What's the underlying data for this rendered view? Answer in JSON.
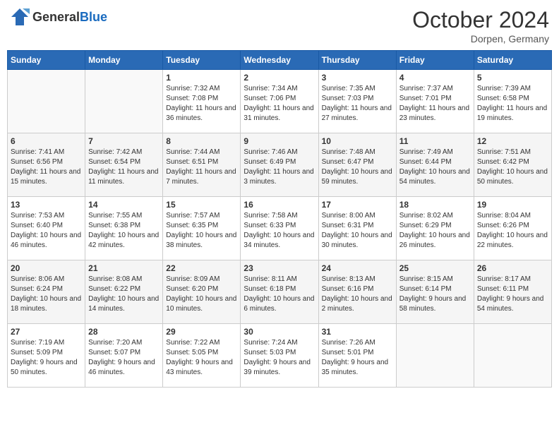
{
  "header": {
    "logo_general": "General",
    "logo_blue": "Blue",
    "month": "October 2024",
    "location": "Dorpen, Germany"
  },
  "weekdays": [
    "Sunday",
    "Monday",
    "Tuesday",
    "Wednesday",
    "Thursday",
    "Friday",
    "Saturday"
  ],
  "weeks": [
    [
      {
        "day": "",
        "empty": true
      },
      {
        "day": "",
        "empty": true
      },
      {
        "day": "1",
        "sunrise": "Sunrise: 7:32 AM",
        "sunset": "Sunset: 7:08 PM",
        "daylight": "Daylight: 11 hours and 36 minutes."
      },
      {
        "day": "2",
        "sunrise": "Sunrise: 7:34 AM",
        "sunset": "Sunset: 7:06 PM",
        "daylight": "Daylight: 11 hours and 31 minutes."
      },
      {
        "day": "3",
        "sunrise": "Sunrise: 7:35 AM",
        "sunset": "Sunset: 7:03 PM",
        "daylight": "Daylight: 11 hours and 27 minutes."
      },
      {
        "day": "4",
        "sunrise": "Sunrise: 7:37 AM",
        "sunset": "Sunset: 7:01 PM",
        "daylight": "Daylight: 11 hours and 23 minutes."
      },
      {
        "day": "5",
        "sunrise": "Sunrise: 7:39 AM",
        "sunset": "Sunset: 6:58 PM",
        "daylight": "Daylight: 11 hours and 19 minutes."
      }
    ],
    [
      {
        "day": "6",
        "sunrise": "Sunrise: 7:41 AM",
        "sunset": "Sunset: 6:56 PM",
        "daylight": "Daylight: 11 hours and 15 minutes."
      },
      {
        "day": "7",
        "sunrise": "Sunrise: 7:42 AM",
        "sunset": "Sunset: 6:54 PM",
        "daylight": "Daylight: 11 hours and 11 minutes."
      },
      {
        "day": "8",
        "sunrise": "Sunrise: 7:44 AM",
        "sunset": "Sunset: 6:51 PM",
        "daylight": "Daylight: 11 hours and 7 minutes."
      },
      {
        "day": "9",
        "sunrise": "Sunrise: 7:46 AM",
        "sunset": "Sunset: 6:49 PM",
        "daylight": "Daylight: 11 hours and 3 minutes."
      },
      {
        "day": "10",
        "sunrise": "Sunrise: 7:48 AM",
        "sunset": "Sunset: 6:47 PM",
        "daylight": "Daylight: 10 hours and 59 minutes."
      },
      {
        "day": "11",
        "sunrise": "Sunrise: 7:49 AM",
        "sunset": "Sunset: 6:44 PM",
        "daylight": "Daylight: 10 hours and 54 minutes."
      },
      {
        "day": "12",
        "sunrise": "Sunrise: 7:51 AM",
        "sunset": "Sunset: 6:42 PM",
        "daylight": "Daylight: 10 hours and 50 minutes."
      }
    ],
    [
      {
        "day": "13",
        "sunrise": "Sunrise: 7:53 AM",
        "sunset": "Sunset: 6:40 PM",
        "daylight": "Daylight: 10 hours and 46 minutes."
      },
      {
        "day": "14",
        "sunrise": "Sunrise: 7:55 AM",
        "sunset": "Sunset: 6:38 PM",
        "daylight": "Daylight: 10 hours and 42 minutes."
      },
      {
        "day": "15",
        "sunrise": "Sunrise: 7:57 AM",
        "sunset": "Sunset: 6:35 PM",
        "daylight": "Daylight: 10 hours and 38 minutes."
      },
      {
        "day": "16",
        "sunrise": "Sunrise: 7:58 AM",
        "sunset": "Sunset: 6:33 PM",
        "daylight": "Daylight: 10 hours and 34 minutes."
      },
      {
        "day": "17",
        "sunrise": "Sunrise: 8:00 AM",
        "sunset": "Sunset: 6:31 PM",
        "daylight": "Daylight: 10 hours and 30 minutes."
      },
      {
        "day": "18",
        "sunrise": "Sunrise: 8:02 AM",
        "sunset": "Sunset: 6:29 PM",
        "daylight": "Daylight: 10 hours and 26 minutes."
      },
      {
        "day": "19",
        "sunrise": "Sunrise: 8:04 AM",
        "sunset": "Sunset: 6:26 PM",
        "daylight": "Daylight: 10 hours and 22 minutes."
      }
    ],
    [
      {
        "day": "20",
        "sunrise": "Sunrise: 8:06 AM",
        "sunset": "Sunset: 6:24 PM",
        "daylight": "Daylight: 10 hours and 18 minutes."
      },
      {
        "day": "21",
        "sunrise": "Sunrise: 8:08 AM",
        "sunset": "Sunset: 6:22 PM",
        "daylight": "Daylight: 10 hours and 14 minutes."
      },
      {
        "day": "22",
        "sunrise": "Sunrise: 8:09 AM",
        "sunset": "Sunset: 6:20 PM",
        "daylight": "Daylight: 10 hours and 10 minutes."
      },
      {
        "day": "23",
        "sunrise": "Sunrise: 8:11 AM",
        "sunset": "Sunset: 6:18 PM",
        "daylight": "Daylight: 10 hours and 6 minutes."
      },
      {
        "day": "24",
        "sunrise": "Sunrise: 8:13 AM",
        "sunset": "Sunset: 6:16 PM",
        "daylight": "Daylight: 10 hours and 2 minutes."
      },
      {
        "day": "25",
        "sunrise": "Sunrise: 8:15 AM",
        "sunset": "Sunset: 6:14 PM",
        "daylight": "Daylight: 9 hours and 58 minutes."
      },
      {
        "day": "26",
        "sunrise": "Sunrise: 8:17 AM",
        "sunset": "Sunset: 6:11 PM",
        "daylight": "Daylight: 9 hours and 54 minutes."
      }
    ],
    [
      {
        "day": "27",
        "sunrise": "Sunrise: 7:19 AM",
        "sunset": "Sunset: 5:09 PM",
        "daylight": "Daylight: 9 hours and 50 minutes."
      },
      {
        "day": "28",
        "sunrise": "Sunrise: 7:20 AM",
        "sunset": "Sunset: 5:07 PM",
        "daylight": "Daylight: 9 hours and 46 minutes."
      },
      {
        "day": "29",
        "sunrise": "Sunrise: 7:22 AM",
        "sunset": "Sunset: 5:05 PM",
        "daylight": "Daylight: 9 hours and 43 minutes."
      },
      {
        "day": "30",
        "sunrise": "Sunrise: 7:24 AM",
        "sunset": "Sunset: 5:03 PM",
        "daylight": "Daylight: 9 hours and 39 minutes."
      },
      {
        "day": "31",
        "sunrise": "Sunrise: 7:26 AM",
        "sunset": "Sunset: 5:01 PM",
        "daylight": "Daylight: 9 hours and 35 minutes."
      },
      {
        "day": "",
        "empty": true
      },
      {
        "day": "",
        "empty": true
      }
    ]
  ]
}
